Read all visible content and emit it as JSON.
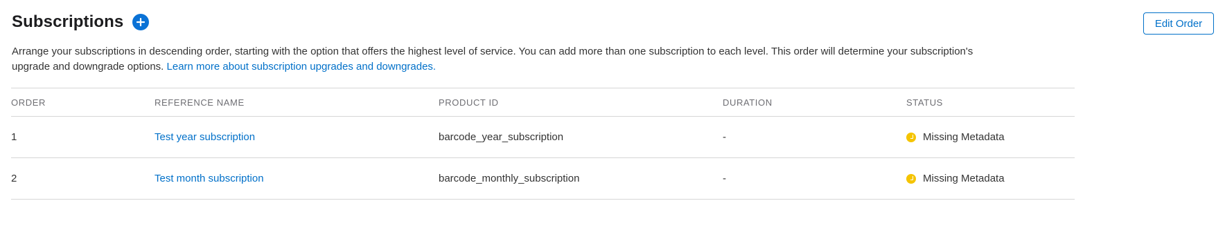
{
  "header": {
    "title": "Subscriptions",
    "edit_order_label": "Edit Order"
  },
  "description": {
    "text": "Arrange your subscriptions in descending order, starting with the option that offers the highest level of service. You can add more than one subscription to each level. This order will determine your subscription's upgrade and downgrade options. ",
    "link": "Learn more about subscription upgrades and downgrades."
  },
  "table": {
    "columns": [
      "ORDER",
      "REFERENCE NAME",
      "PRODUCT ID",
      "DURATION",
      "STATUS"
    ],
    "rows": [
      {
        "order": "1",
        "reference_name": "Test year subscription",
        "product_id": "barcode_year_subscription",
        "duration": "-",
        "status": "Missing Metadata"
      },
      {
        "order": "2",
        "reference_name": "Test month subscription",
        "product_id": "barcode_monthly_subscription",
        "duration": "-",
        "status": "Missing Metadata"
      }
    ]
  },
  "icons": {
    "add": "plus-circle-icon",
    "status": "clock-icon"
  },
  "colors": {
    "accent": "#0070c9",
    "add_button": "#0a72d6",
    "status_pending": "#f5c400",
    "divider": "#d6d6d6"
  }
}
